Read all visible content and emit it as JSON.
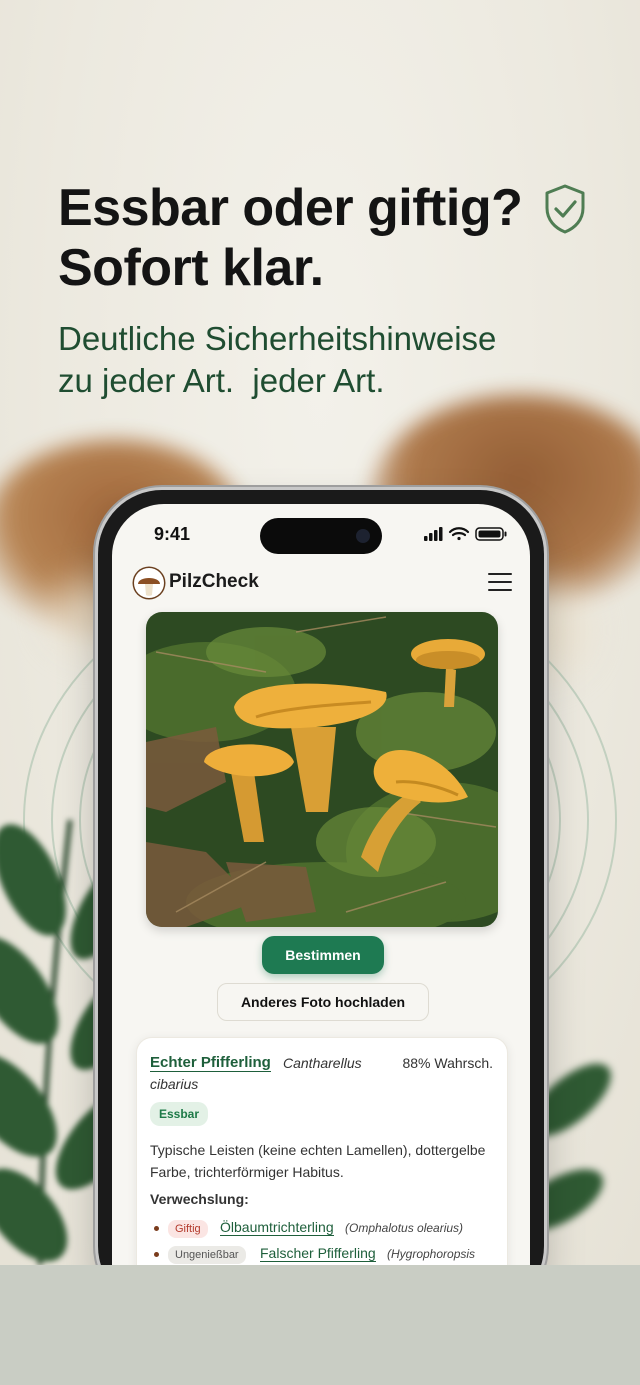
{
  "marketing": {
    "headline_line1": "Essbar oder giftig?",
    "headline_line2": "Sofort klar.",
    "subhead_line1": "Deutliche Sicherheitshinweise",
    "subhead_line2": "zu jeder Art.  jeder Art."
  },
  "status_bar": {
    "time": "9:41"
  },
  "app": {
    "brand": "PilzCheck",
    "identify_button": "Bestimmen",
    "upload_button": "Anderes Foto hochladen"
  },
  "result": {
    "name": "Echter Pfifferling",
    "latin_part1": "Cantharellus",
    "latin_part2": "cibarius",
    "probability": "88% Wahrsch.",
    "edibility": "Essbar",
    "description": "Typische Leisten (keine echten Lamellen), dottergelbe Farbe, trichterförmiger Habitus.",
    "confusion_heading": "Verwechslung:",
    "confusions": [
      {
        "badge": "Giftig",
        "name": "Ölbaumtrichterling",
        "latin": "(Omphalotus olearius)"
      },
      {
        "badge": "Ungenießbar",
        "name": "Falscher Pfifferling",
        "latin": "(Hygrophoropsis"
      }
    ]
  },
  "colors": {
    "accent_green": "#1e7a52",
    "link_green": "#1e5f3b",
    "toxic_red": "#b33a2c",
    "background": "#efece3"
  }
}
